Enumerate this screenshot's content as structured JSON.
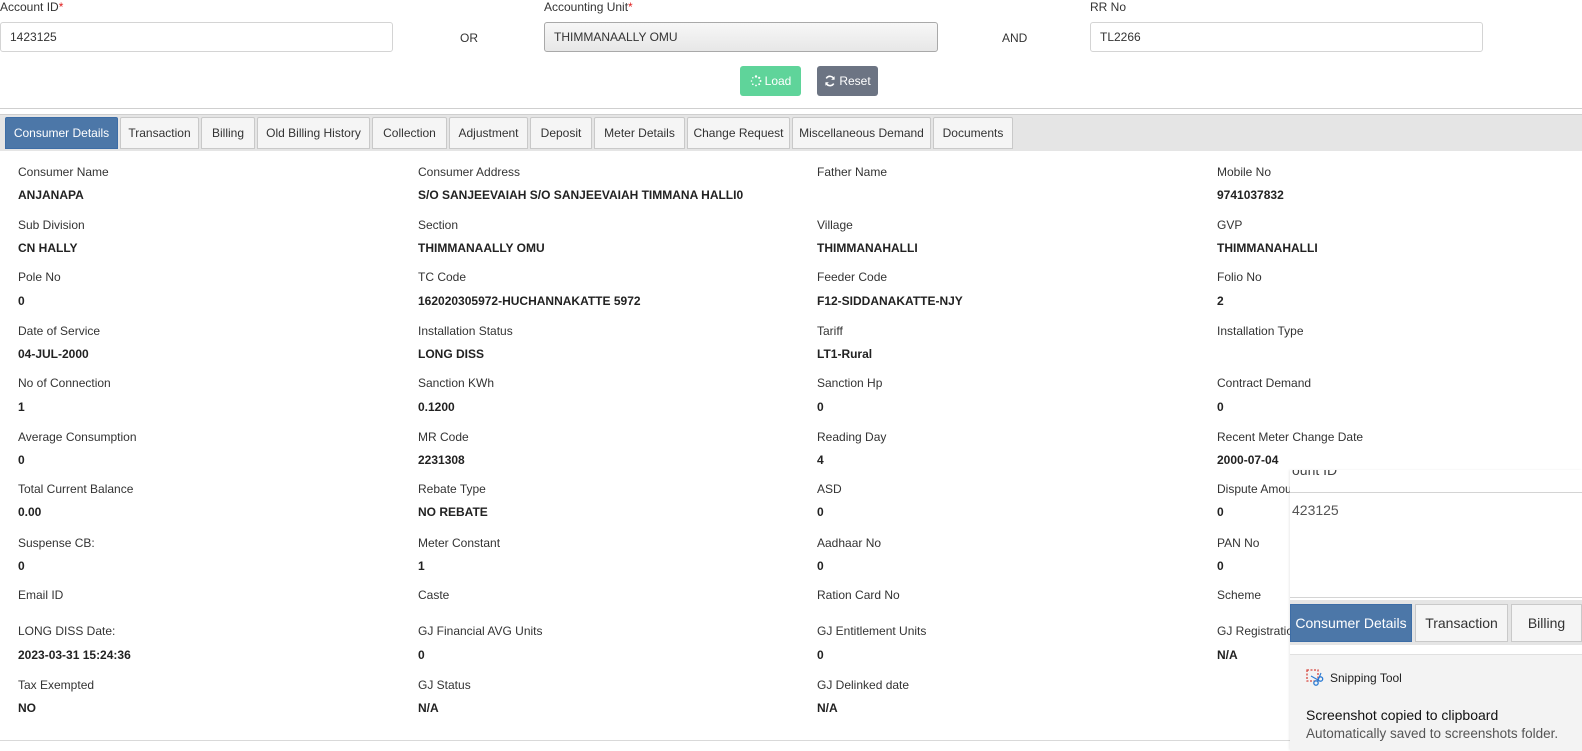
{
  "search": {
    "account_id_label": "Account ID",
    "required_mark": "*",
    "account_id_value": "1423125",
    "or_label": "OR",
    "accounting_unit_label": "Accounting Unit",
    "accounting_unit_value": "THIMMANAALLY OMU",
    "and_label": "AND",
    "rr_no_label": "RR No",
    "rr_no_value": "TL2266",
    "load_label": "Load",
    "reset_label": "Reset"
  },
  "tabs": [
    {
      "label": "Consumer Details",
      "active": true
    },
    {
      "label": "Transaction"
    },
    {
      "label": "Billing"
    },
    {
      "label": "Old Billing History"
    },
    {
      "label": "Collection"
    },
    {
      "label": "Adjustment"
    },
    {
      "label": "Deposit"
    },
    {
      "label": "Meter Details"
    },
    {
      "label": "Change Request"
    },
    {
      "label": "Miscellaneous Demand"
    },
    {
      "label": "Documents"
    }
  ],
  "details": [
    [
      {
        "label": "Consumer Name",
        "value": "ANJANAPA"
      },
      {
        "label": "Consumer Address",
        "value": "S/O SANJEEVAIAH S/O SANJEEVAIAH TIMMANA HALLI0"
      },
      {
        "label": "Father Name",
        "value": ""
      },
      {
        "label": "Mobile No",
        "value": "9741037832"
      }
    ],
    [
      {
        "label": "Sub Division",
        "value": "CN HALLY"
      },
      {
        "label": "Section",
        "value": "THIMMANAALLY OMU"
      },
      {
        "label": "Village",
        "value": "THIMMANAHALLI"
      },
      {
        "label": "GVP",
        "value": "THIMMANAHALLI"
      }
    ],
    [
      {
        "label": "Pole No",
        "value": "0"
      },
      {
        "label": "TC Code",
        "value": "162020305972-HUCHANNAKATTE 5972"
      },
      {
        "label": "Feeder Code",
        "value": "F12-SIDDANAKATTE-NJY"
      },
      {
        "label": "Folio No",
        "value": "2"
      }
    ],
    [
      {
        "label": "Date of Service",
        "value": "04-JUL-2000"
      },
      {
        "label": "Installation Status",
        "value": "LONG DISS"
      },
      {
        "label": "Tariff",
        "value": "LT1-Rural"
      },
      {
        "label": "Installation Type",
        "value": ""
      }
    ],
    [
      {
        "label": "No of Connection",
        "value": "1"
      },
      {
        "label": "Sanction KWh",
        "value": "0.1200"
      },
      {
        "label": "Sanction Hp",
        "value": "0"
      },
      {
        "label": "Contract Demand",
        "value": "0"
      }
    ],
    [
      {
        "label": "Average Consumption",
        "value": "0"
      },
      {
        "label": "MR Code",
        "value": "2231308"
      },
      {
        "label": "Reading Day",
        "value": "4"
      },
      {
        "label": "Recent Meter Change Date",
        "value": "2000-07-04"
      }
    ],
    [
      {
        "label": "Total Current Balance",
        "value": "0.00"
      },
      {
        "label": "Rebate Type",
        "value": "NO REBATE"
      },
      {
        "label": "ASD",
        "value": "0"
      },
      {
        "label": "Dispute Amour",
        "value": "0"
      }
    ],
    [
      {
        "label": "Suspense CB:",
        "value": "0"
      },
      {
        "label": "Meter Constant",
        "value": "1"
      },
      {
        "label": "Aadhaar No",
        "value": "0"
      },
      {
        "label": "PAN No",
        "value": "0"
      }
    ],
    [
      {
        "label": "Email ID",
        "value": ""
      },
      {
        "label": "Caste",
        "value": ""
      },
      {
        "label": "Ration Card No",
        "value": ""
      },
      {
        "label": "Scheme",
        "value": ""
      }
    ],
    [
      {
        "label": "LONG DISS Date:",
        "value": "2023-03-31 15:24:36"
      },
      {
        "label": "GJ Financial AVG Units",
        "value": "0"
      },
      {
        "label": "GJ Entitlement Units",
        "value": "0"
      },
      {
        "label": "GJ Registration",
        "value": "N/A"
      }
    ],
    [
      {
        "label": "Tax Exempted",
        "value": "NO"
      },
      {
        "label": "GJ Status",
        "value": "N/A"
      },
      {
        "label": "GJ Delinked date",
        "value": "N/A"
      },
      {
        "label": "",
        "value": ""
      }
    ]
  ],
  "overlay": {
    "cut_label": "ount ID",
    "account_value": "423125",
    "tabs": [
      "Consumer Details",
      "Transaction",
      "Billing"
    ]
  },
  "toast": {
    "app_name": "Snipping Tool",
    "title": "Screenshot copied to clipboard",
    "subtitle": "Automatically saved to screenshots folder."
  },
  "colors": {
    "active_tab": "#4c77a8",
    "load_button": "#5fd49a",
    "reset_button": "#6c7483",
    "required": "#e02020"
  },
  "icons": [
    "spinner-icon",
    "refresh-icon",
    "snipping-tool-icon"
  ]
}
